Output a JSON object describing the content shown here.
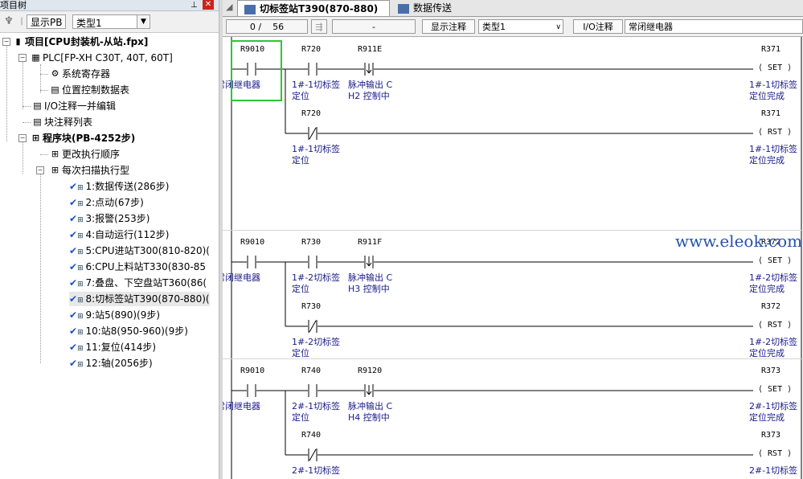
{
  "left_pane": {
    "title": "项目树",
    "toolbar": {
      "show_pb": "显示PB",
      "type_label": "类型1"
    },
    "tree": [
      {
        "label": "项目[CPU封装机-从站.fpx]",
        "bold": true
      },
      {
        "label": "PLC[FP-XH C30T, 40T, 60T]"
      },
      {
        "label": "系统寄存器"
      },
      {
        "label": "位置控制数据表"
      },
      {
        "label": "I/O注释一并编辑"
      },
      {
        "label": "块注释列表"
      },
      {
        "label": "程序块(PB-4252步)",
        "bold": true
      },
      {
        "label": "更改执行顺序"
      },
      {
        "label": "每次扫描执行型"
      },
      {
        "label": "1:数据传送(286步)"
      },
      {
        "label": "2:点动(67步)"
      },
      {
        "label": "3:报警(253步)"
      },
      {
        "label": "4:自动运行(112步)"
      },
      {
        "label": "5:CPU进站T300(810-820)("
      },
      {
        "label": "6:CPU上料站T330(830-85"
      },
      {
        "label": "7:叠盘、下空盘站T360(86("
      },
      {
        "label": "8:切标签站T390(870-880)("
      },
      {
        "label": "9:站5(890)(9步)"
      },
      {
        "label": "10:站8(950-960)(9步)"
      },
      {
        "label": "11:复位(414步)"
      },
      {
        "label": "12:轴(2056步)"
      }
    ]
  },
  "tabs": [
    {
      "label": "切标签站T390(870-880)",
      "active": true
    },
    {
      "label": "数据传送",
      "active": false
    }
  ],
  "editor_toolbar": {
    "position": "0 /",
    "total": "56",
    "field3": "-",
    "show_comments": "显示注释",
    "type_label": "类型1",
    "io_comment_label": "I/O注释",
    "io_comment_value": "常闭继电器"
  },
  "ladder": {
    "rungs": [
      {
        "contacts": [
          {
            "addr": "R9010",
            "comment": "常闭继电器",
            "comment2": ""
          },
          {
            "addr": "R720",
            "comment": "1#-1切标签",
            "comment2": "定位"
          },
          {
            "addr": "R911E",
            "comment": "脉冲输出 C",
            "comment2": "H2 控制中"
          }
        ],
        "coil": {
          "addr": "R371",
          "type": "SET",
          "comment": "1#-1切标签",
          "comment2": "定位完成"
        },
        "branch": {
          "addr": "R720",
          "comment": "1#-1切标签",
          "comment2": "定位"
        },
        "branch_coil": {
          "addr": "R371",
          "type": "RST",
          "comment": "1#-1切标签",
          "comment2": "定位完成"
        }
      },
      {
        "contacts": [
          {
            "addr": "R9010",
            "comment": "常闭继电器",
            "comment2": ""
          },
          {
            "addr": "R730",
            "comment": "1#-2切标签",
            "comment2": "定位"
          },
          {
            "addr": "R911F",
            "comment": "脉冲输出 C",
            "comment2": "H3 控制中"
          }
        ],
        "coil": {
          "addr": "R372",
          "type": "SET",
          "comment": "1#-2切标签",
          "comment2": "定位完成"
        },
        "branch": {
          "addr": "R730",
          "comment": "1#-2切标签",
          "comment2": "定位"
        },
        "branch_coil": {
          "addr": "R372",
          "type": "RST",
          "comment": "1#-2切标签",
          "comment2": "定位完成"
        }
      },
      {
        "contacts": [
          {
            "addr": "R9010",
            "comment": "常闭继电器",
            "comment2": ""
          },
          {
            "addr": "R740",
            "comment": "2#-1切标签",
            "comment2": "定位"
          },
          {
            "addr": "R9120",
            "comment": "脉冲输出 C",
            "comment2": "H4 控制中"
          }
        ],
        "coil": {
          "addr": "R373",
          "type": "SET",
          "comment": "2#-1切标签",
          "comment2": "定位完成"
        },
        "branch": {
          "addr": "R740",
          "comment": "2#-1切标签",
          "comment2": ""
        },
        "branch_coil": {
          "addr": "R373",
          "type": "RST",
          "comment": "2#-1切标签",
          "comment2": ""
        }
      }
    ]
  },
  "watermark": "www.eleok.com"
}
